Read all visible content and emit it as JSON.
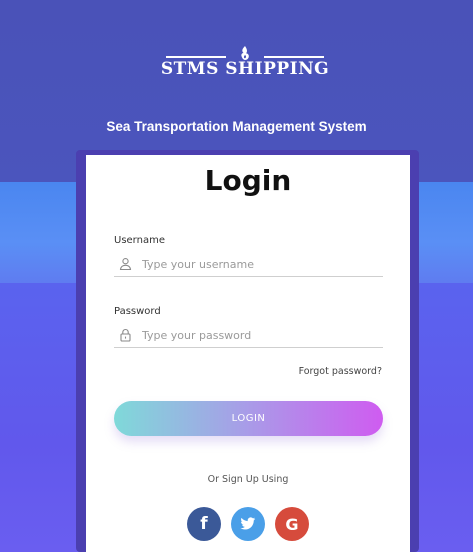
{
  "brand": {
    "logo_text": "STMS SHIPPING",
    "subtitle": "Sea Transportation Management System"
  },
  "login_card": {
    "title": "Login",
    "username": {
      "label": "Username",
      "value": "",
      "placeholder": "Type your username",
      "icon": "user-icon"
    },
    "password": {
      "label": "Password",
      "value": "",
      "placeholder": "Type your password",
      "icon": "lock-icon"
    },
    "forgot_password": "Forgot password?",
    "login_button": "LOGIN",
    "signup_text": "Or Sign Up Using",
    "social": [
      {
        "name": "facebook",
        "glyph": "f",
        "icon": "facebook-icon",
        "color": "#3b5998"
      },
      {
        "name": "twitter",
        "glyph": "",
        "icon": "twitter-icon",
        "color": "#4a9fe8"
      },
      {
        "name": "google",
        "glyph": "G",
        "icon": "google-icon",
        "color": "#d64b3c"
      }
    ]
  },
  "colors": {
    "header_bg": "#4a52b8",
    "band_blue": "#4a86f0",
    "lower_bg": "#6158ec",
    "button_gradient_start": "#7fd9d9",
    "button_gradient_end": "#cf5cf0"
  }
}
